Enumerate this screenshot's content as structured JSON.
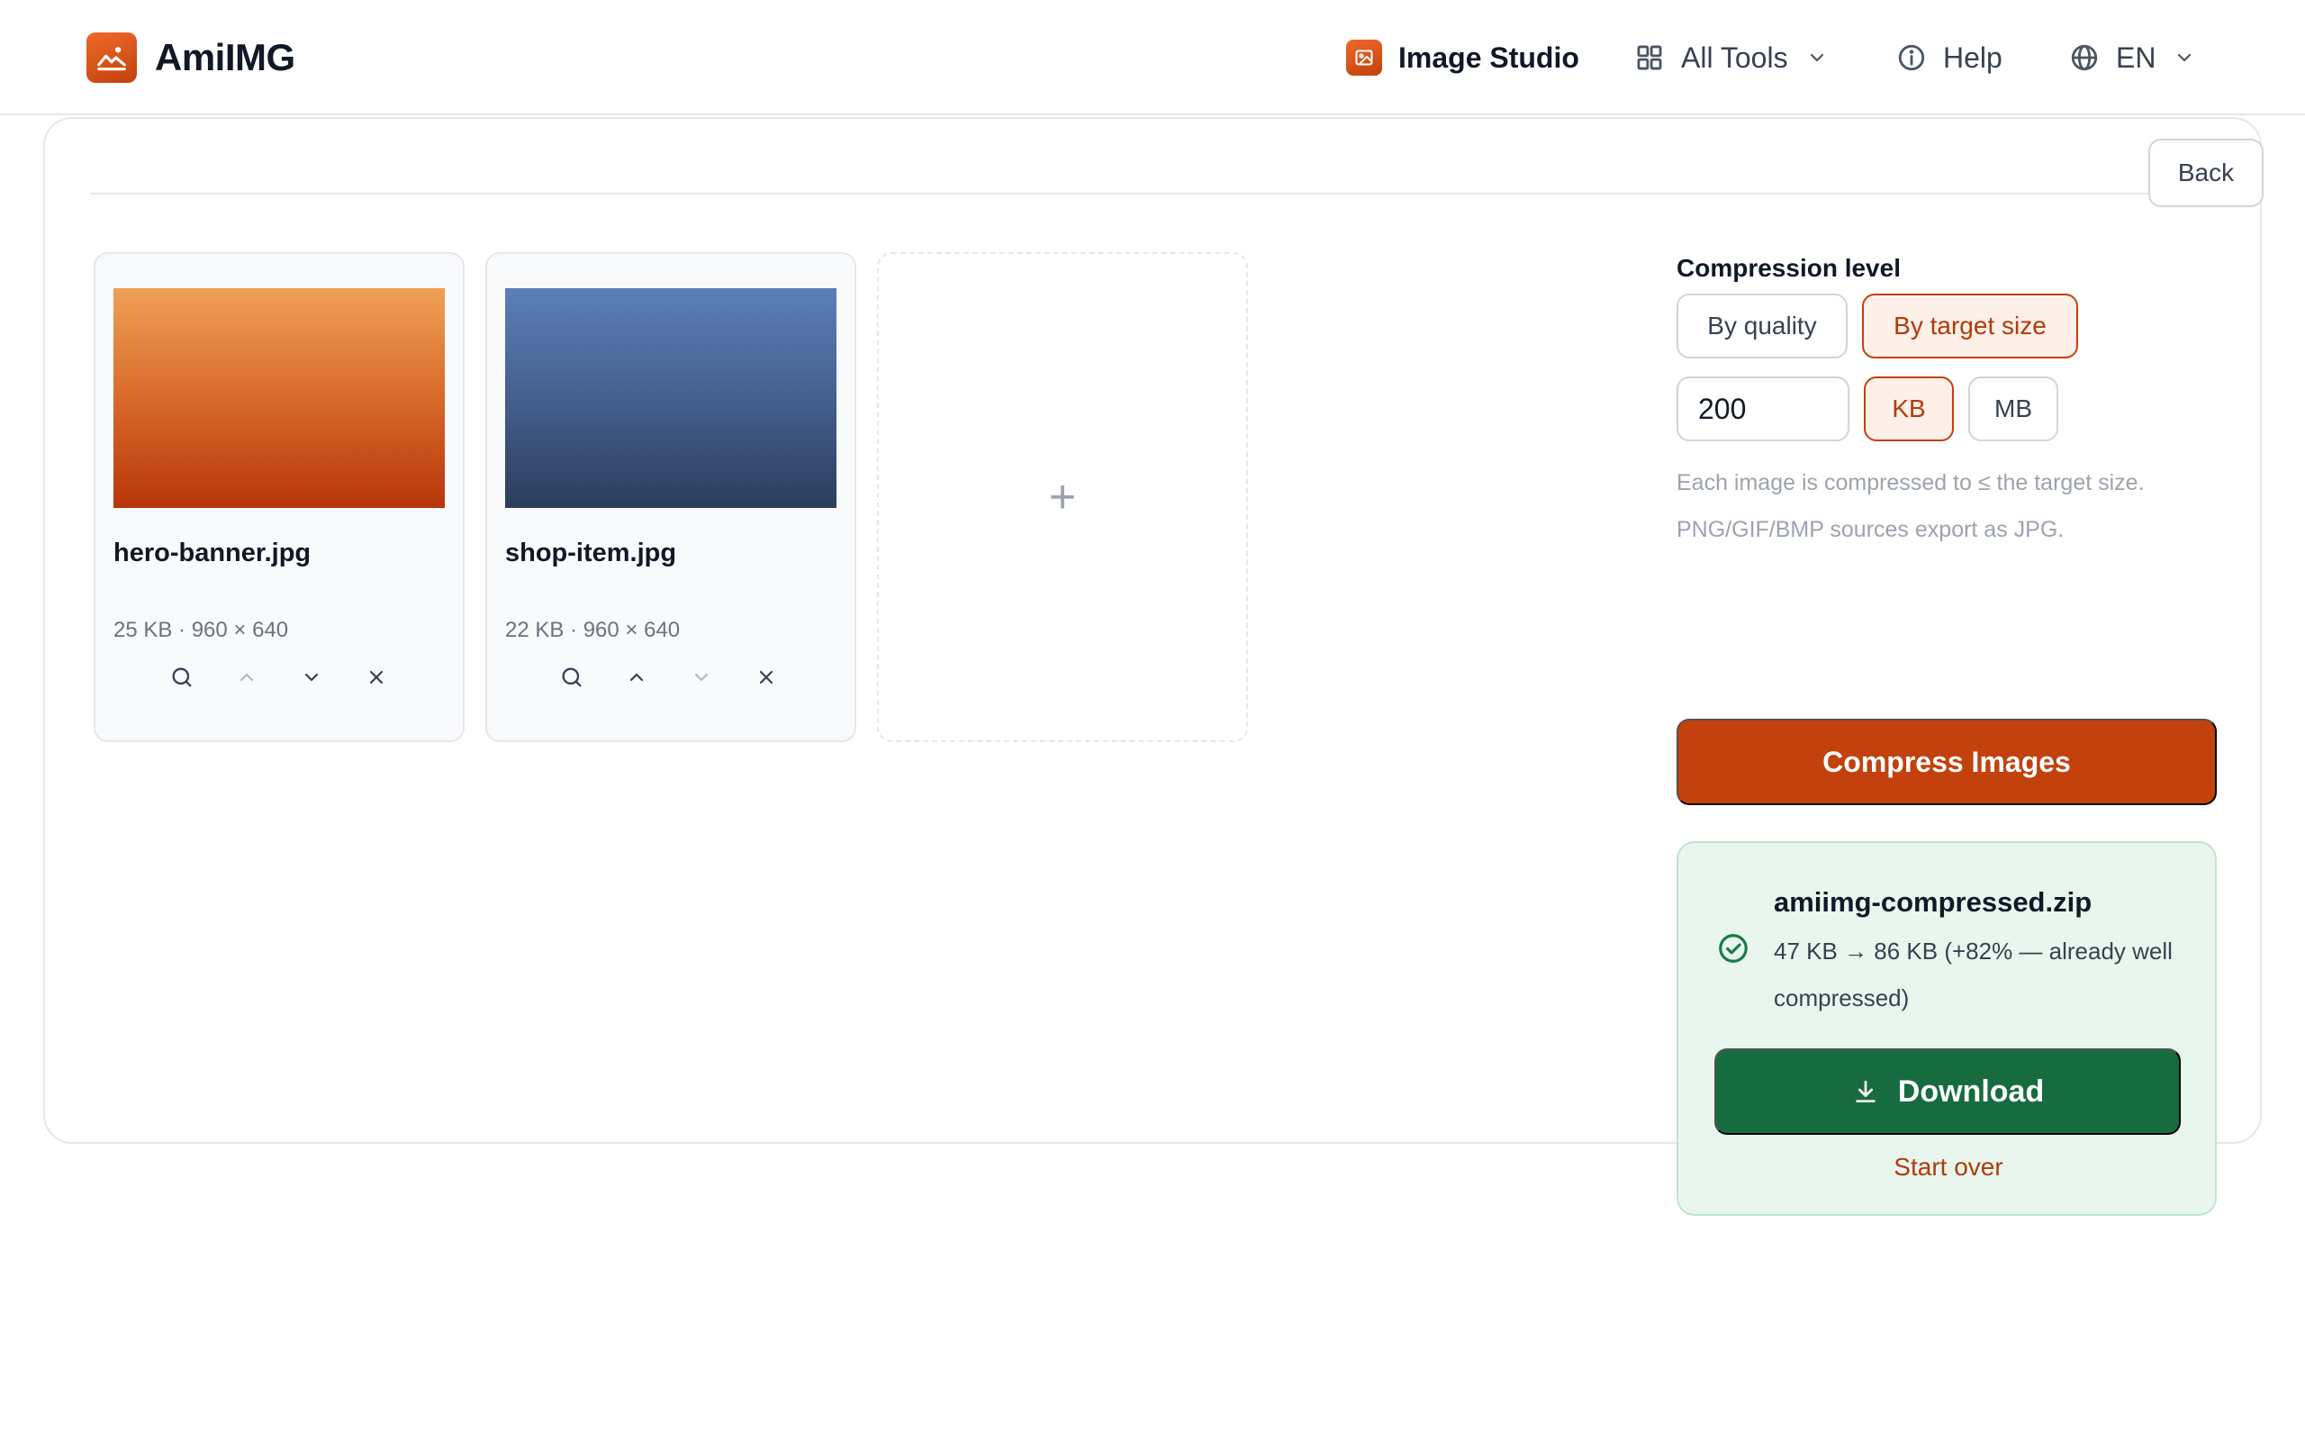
{
  "header": {
    "brand": "AmiIMG",
    "nav": {
      "studio": "Image Studio",
      "tools": "All Tools",
      "help": "Help",
      "language": "EN"
    }
  },
  "card": {
    "back_label": "Back"
  },
  "images": [
    {
      "name": "hero-banner.jpg",
      "meta": "25 KB · 960 × 640",
      "thumb_color": "#d86a2c"
    },
    {
      "name": "shop-item.jpg",
      "meta": "22 KB · 960 × 640",
      "thumb_color": "#44608f"
    }
  ],
  "add_tile": {
    "label": "+"
  },
  "compression": {
    "label": "Compression level",
    "mode_quality": "By quality",
    "mode_target": "By target size",
    "selected_mode": "By target size",
    "target_value": "200",
    "unit_kb": "KB",
    "unit_mb": "MB",
    "selected_unit": "KB",
    "hint": "Each image is compressed to ≤ the target size. PNG/GIF/BMP sources export as JPG.",
    "compress_button": "Compress Images"
  },
  "result": {
    "file_name": "amiimg-compressed.zip",
    "stats": "47 KB → 86 KB (+82% — already well compressed)",
    "download_button": "Download",
    "start_over": "Start over"
  },
  "colors": {
    "accent": "#c2410c",
    "accent_soft": "#fdf0e8",
    "success": "#166c3f",
    "success_soft": "#e8f6ee"
  }
}
